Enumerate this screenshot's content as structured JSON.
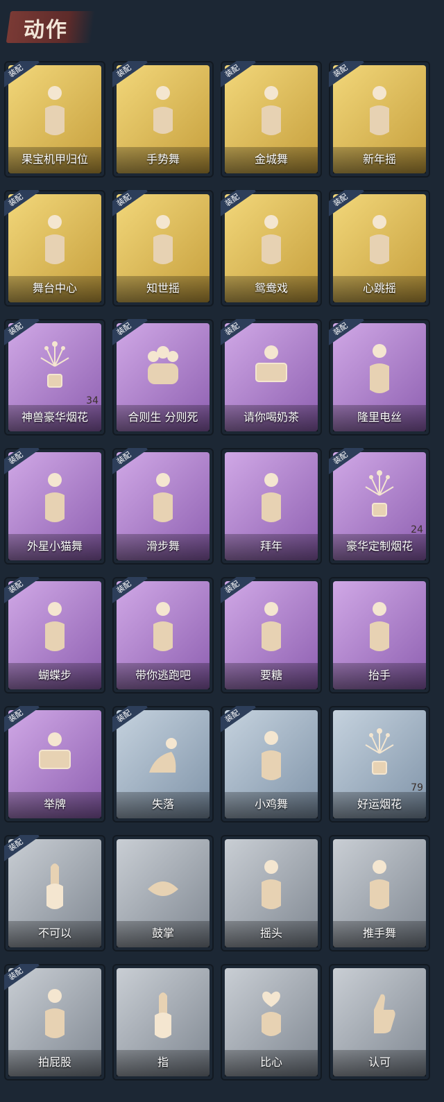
{
  "header": {
    "title": "动作"
  },
  "equip_tag": "装配",
  "cards": [
    {
      "label": "果宝机甲归位",
      "tier": "gold",
      "equipped": true,
      "icon": "dance-pose-icon"
    },
    {
      "label": "手势舞",
      "tier": "gold",
      "equipped": true,
      "icon": "hand-dance-icon"
    },
    {
      "label": "金城舞",
      "tier": "gold",
      "equipped": true,
      "icon": "dance-pose-icon"
    },
    {
      "label": "新年摇",
      "tier": "gold",
      "equipped": true,
      "icon": "dance-pose-icon"
    },
    {
      "label": "舞台中心",
      "tier": "gold",
      "equipped": true,
      "icon": "dance-pose-icon"
    },
    {
      "label": "知世摇",
      "tier": "gold",
      "equipped": true,
      "icon": "dance-pose-icon"
    },
    {
      "label": "鸳鸯戏",
      "tier": "gold",
      "equipped": true,
      "icon": "dance-pose-icon"
    },
    {
      "label": "心跳摇",
      "tier": "gold",
      "equipped": true,
      "icon": "dance-pose-icon"
    },
    {
      "label": "神兽豪华烟花",
      "tier": "purple",
      "equipped": true,
      "icon": "firework-icon",
      "count": "34"
    },
    {
      "label": "合则生 分则死",
      "tier": "purple",
      "equipped": true,
      "icon": "group-icon"
    },
    {
      "label": "请你喝奶茶",
      "tier": "purple",
      "equipped": true,
      "icon": "sign-icon"
    },
    {
      "label": "隆里电丝",
      "tier": "purple",
      "equipped": true,
      "icon": "dance-pose-icon"
    },
    {
      "label": "外星小猫舞",
      "tier": "purple",
      "equipped": true,
      "icon": "dance-pose-icon"
    },
    {
      "label": "滑步舞",
      "tier": "purple",
      "equipped": true,
      "icon": "dance-pose-icon"
    },
    {
      "label": "拜年",
      "tier": "purple",
      "equipped": false,
      "icon": "dance-pose-icon"
    },
    {
      "label": "豪华定制烟花",
      "tier": "purple",
      "equipped": true,
      "icon": "firework-icon",
      "count": "24"
    },
    {
      "label": "蝴蝶步",
      "tier": "purple",
      "equipped": true,
      "icon": "dance-pose-icon"
    },
    {
      "label": "带你逃跑吧",
      "tier": "purple",
      "equipped": true,
      "icon": "dance-pose-icon"
    },
    {
      "label": "要糖",
      "tier": "purple",
      "equipped": true,
      "icon": "dance-pose-icon"
    },
    {
      "label": "抬手",
      "tier": "purple",
      "equipped": false,
      "icon": "dance-pose-icon"
    },
    {
      "label": "举牌",
      "tier": "purple",
      "equipped": true,
      "icon": "sign-icon"
    },
    {
      "label": "失落",
      "tier": "blue",
      "equipped": true,
      "icon": "crawl-icon"
    },
    {
      "label": "小鸡舞",
      "tier": "blue",
      "equipped": true,
      "icon": "dance-pose-icon"
    },
    {
      "label": "好运烟花",
      "tier": "blue",
      "equipped": false,
      "icon": "firework-icon",
      "count": "79"
    },
    {
      "label": "不可以",
      "tier": "gray",
      "equipped": true,
      "icon": "finger-icon"
    },
    {
      "label": "鼓掌",
      "tier": "gray",
      "equipped": false,
      "icon": "hands-icon"
    },
    {
      "label": "摇头",
      "tier": "gray",
      "equipped": false,
      "icon": "dance-pose-icon"
    },
    {
      "label": "推手舞",
      "tier": "gray",
      "equipped": false,
      "icon": "dance-pose-icon"
    },
    {
      "label": "拍屁股",
      "tier": "gray",
      "equipped": true,
      "icon": "dance-pose-icon"
    },
    {
      "label": "指",
      "tier": "gray",
      "equipped": false,
      "icon": "point-icon"
    },
    {
      "label": "比心",
      "tier": "gray",
      "equipped": false,
      "icon": "heart-hand-icon"
    },
    {
      "label": "认可",
      "tier": "gray",
      "equipped": false,
      "icon": "thumbs-up-icon"
    }
  ]
}
